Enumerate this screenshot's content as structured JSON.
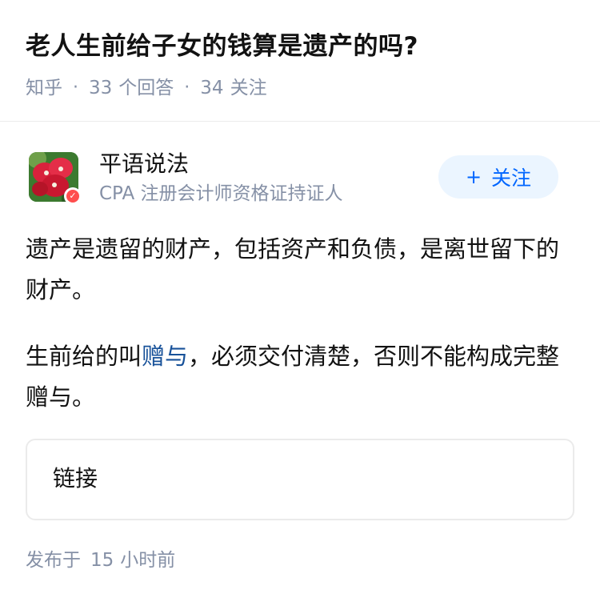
{
  "question": {
    "title": "老人生前给子女的钱算是遗产的吗?",
    "source": "知乎",
    "answers_count": "33",
    "answers_label": "个回答",
    "followers_count": "34",
    "followers_label": "关注"
  },
  "author": {
    "name": "平语说法",
    "description": "CPA 注册会计师资格证持证人",
    "avatar_icon": "flower-avatar",
    "badge_icon": "verified-badge-icon",
    "follow_plus": "+",
    "follow_label": "关注"
  },
  "answer": {
    "paragraph1": "遗产是遗留的财产，包括资产和负债，是离世留下的财产。",
    "paragraph2_before": "生前给的叫",
    "paragraph2_link": "赠与",
    "paragraph2_after": "，必须交付清楚，否则不能构成完整赠与。",
    "link_card_label": "链接"
  },
  "publish": {
    "prefix": "发布于",
    "count": "15",
    "unit": "小时前"
  },
  "colors": {
    "text_primary": "#121212",
    "text_secondary": "#8590a6",
    "brand_blue": "#0066ff",
    "link_blue": "#175199",
    "follow_bg": "#ebf5ff"
  }
}
